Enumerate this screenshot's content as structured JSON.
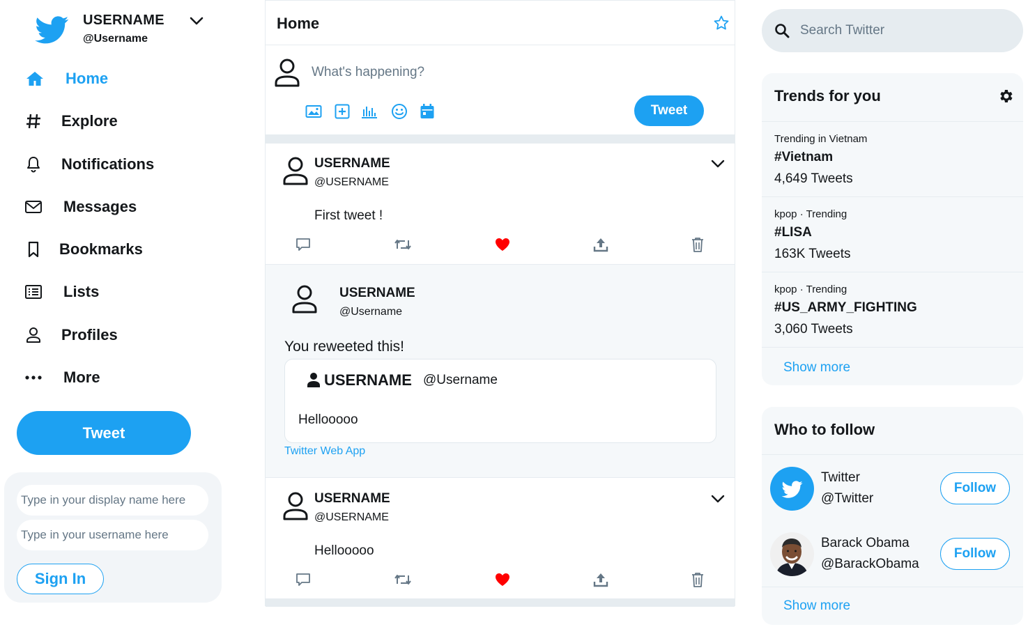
{
  "account": {
    "name": "USERNAME",
    "handle": "@Username"
  },
  "nav": [
    {
      "label": "Home",
      "icon": "home-icon",
      "active": true
    },
    {
      "label": "Explore",
      "icon": "hashtag-icon"
    },
    {
      "label": "Notifications",
      "icon": "bell-icon"
    },
    {
      "label": "Messages",
      "icon": "envelope-icon"
    },
    {
      "label": "Bookmarks",
      "icon": "bookmark-icon"
    },
    {
      "label": "Lists",
      "icon": "list-icon"
    },
    {
      "label": "Profiles",
      "icon": "user-icon"
    },
    {
      "label": "More",
      "icon": "more-dots-icon"
    }
  ],
  "tweet_button_label": "Tweet",
  "signin": {
    "display_name_placeholder": "Type in your display name here",
    "username_placeholder": "Type in your username here",
    "button_label": "Sign In"
  },
  "feed": {
    "title": "Home",
    "compose_placeholder": "What's happening?",
    "compose_tools": [
      "image-icon",
      "add-icon",
      "poll-icon",
      "emoji-icon",
      "schedule-icon"
    ],
    "tweet_label": "Tweet",
    "posts": [
      {
        "name": "USERNAME",
        "handle": "@USERNAME",
        "text": "First tweet !"
      },
      {
        "name": "USERNAME",
        "handle": "@USERNAME",
        "text": "Hellooooo"
      }
    ],
    "retweet": {
      "name": "USERNAME",
      "handle": "@Username",
      "note": "You reweeted this!",
      "quoted": {
        "name": "USERNAME",
        "handle": "@Username",
        "text": "Hellooooo"
      },
      "source": "Twitter Web App"
    }
  },
  "search": {
    "placeholder": "Search Twitter"
  },
  "trends": {
    "title": "Trends for you",
    "items": [
      {
        "context": "Trending in Vietnam",
        "tag": "#Vietnam",
        "count": "4,649 Tweets"
      },
      {
        "context": "kpop · Trending",
        "tag": "#LISA",
        "count": "163K Tweets"
      },
      {
        "context": "kpop · Trending",
        "tag": "#US_ARMY_FIGHTING",
        "count": "3,060 Tweets"
      }
    ],
    "show_more": "Show more"
  },
  "who_to_follow": {
    "title": "Who to follow",
    "items": [
      {
        "name": "Twitter",
        "handle": "@Twitter",
        "button": "Follow"
      },
      {
        "name": "Barack Obama",
        "handle": "@BarackObama",
        "button": "Follow"
      }
    ],
    "show_more": "Show more"
  },
  "colors": {
    "accent": "#1da1f2",
    "like": "#e0245e",
    "panel_bg": "#f5f8fa"
  }
}
